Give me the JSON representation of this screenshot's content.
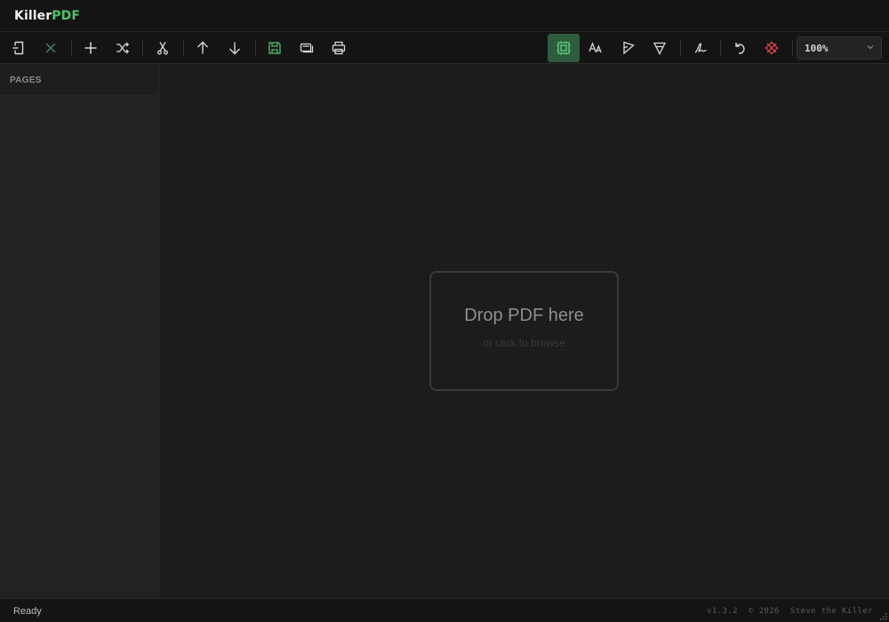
{
  "app": {
    "logo_part1": "Killer",
    "logo_part2": "PDF"
  },
  "toolbar": {
    "open_icon": "open-file-icon",
    "close_icon": "close-icon",
    "add_icon": "plus-icon",
    "shuffle_icon": "shuffle-icon",
    "cut_icon": "scissors-icon",
    "move_up_icon": "arrow-up-icon",
    "move_down_icon": "arrow-down-icon",
    "save_icon": "floppy-disk-icon",
    "save_as_icon": "copy-icon",
    "print_icon": "printer-icon",
    "active_tool": "ocr-select-icon",
    "text_tool_icon": "text-size-icon",
    "highlight_icon": "highlighter-icon",
    "marker_icon": "marker-icon",
    "sign_icon": "signature-icon",
    "undo_icon": "undo-icon",
    "clear_icon": "clear-annotations-icon",
    "zoom_value": "100%"
  },
  "sidebar": {
    "heading": "PAGES"
  },
  "main": {
    "drop_title": "Drop PDF here",
    "drop_subtitle": "or click to browse"
  },
  "status": {
    "text": "Ready",
    "version": "v1.3.2",
    "copyright": "© 2026",
    "author": "Steve the Killer"
  },
  "colors": {
    "accent_green": "#4cc46a",
    "active_tool_bg": "#2d5c3e",
    "danger_red": "#e0443c"
  }
}
